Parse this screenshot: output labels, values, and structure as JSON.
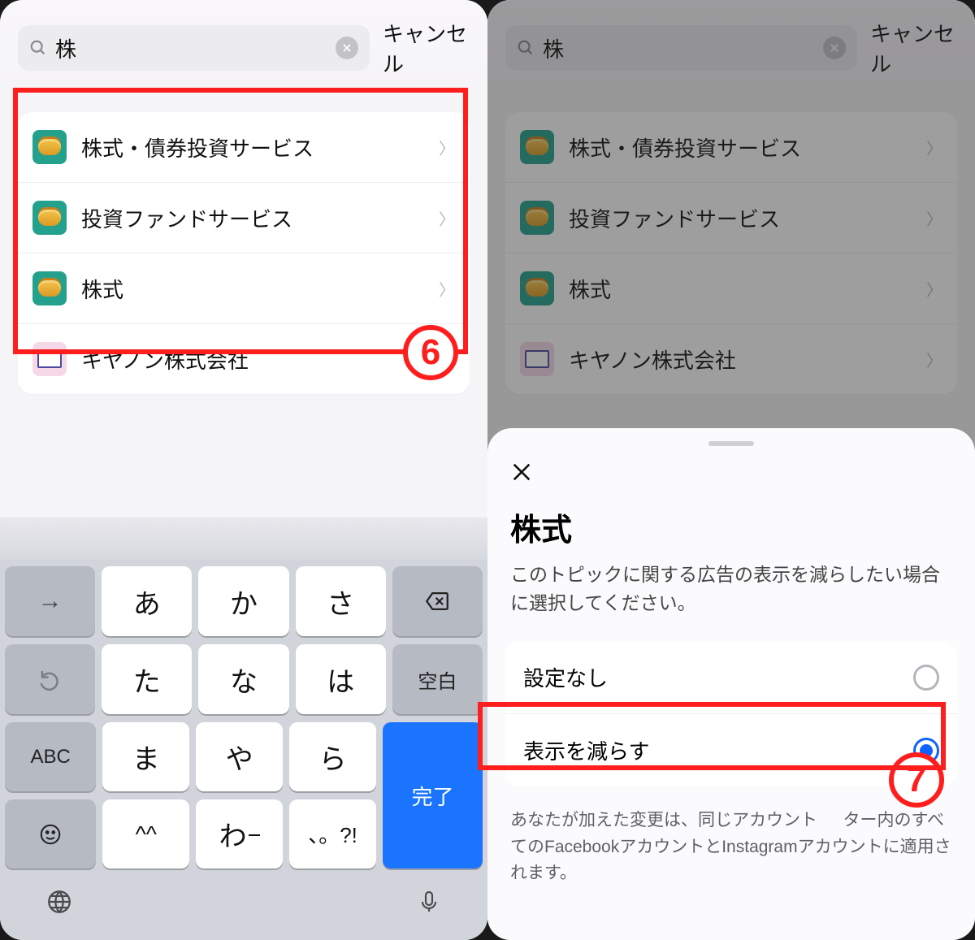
{
  "search": {
    "query": "株",
    "cancel": "キャンセル"
  },
  "results": [
    {
      "label": "株式・債券投資サービス",
      "icon": "coin"
    },
    {
      "label": "投資ファンドサービス",
      "icon": "coin"
    },
    {
      "label": "株式",
      "icon": "coin"
    },
    {
      "label": "キヤノン株式会社",
      "icon": "laptop"
    }
  ],
  "keyboard": {
    "row1": [
      "→",
      "あ",
      "か",
      "さ"
    ],
    "backspace": "⌫",
    "row2": [
      "↺",
      "た",
      "な",
      "は",
      "空白"
    ],
    "row3_left": "ABC",
    "row3_mid": [
      "ま",
      "や",
      "ら"
    ],
    "done": "完了",
    "row4_left": "☺",
    "row4_mid": [
      "^^",
      "わ",
      "、。?!"
    ],
    "globe": "🌐",
    "mic": "🎤"
  },
  "sheet": {
    "title": "株式",
    "subtitle": "このトピックに関する広告の表示を減らしたい場合に選択してください。",
    "options": [
      {
        "label": "設定なし",
        "selected": false
      },
      {
        "label": "表示を減らす",
        "selected": true
      }
    ],
    "footer_1": "あなたが加えた変更は、同じアカウント",
    "footer_2": "ター内のすべてのFacebookアカウントとInstagramアカウントに適用されます。"
  },
  "annotations": {
    "step6": "6",
    "step7": "7"
  }
}
